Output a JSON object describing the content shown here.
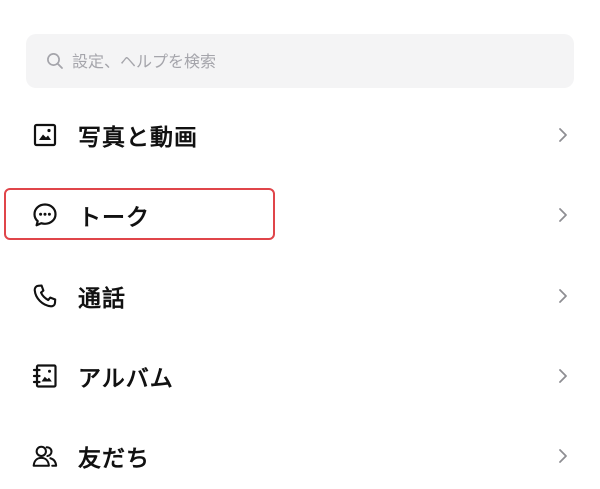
{
  "search": {
    "placeholder": "設定、ヘルプを検索",
    "icon": "search-icon"
  },
  "menu": {
    "items": [
      {
        "label": "写真と動画",
        "icon": "photo-icon"
      },
      {
        "label": "トーク",
        "icon": "chat-bubble-icon"
      },
      {
        "label": "通話",
        "icon": "phone-icon"
      },
      {
        "label": "アルバム",
        "icon": "album-icon"
      },
      {
        "label": "友だち",
        "icon": "friends-icon"
      }
    ],
    "chevron_icon": "chevron-right-icon"
  },
  "colors": {
    "search_bg": "#f4f4f5",
    "placeholder": "#a5a5ab",
    "text": "#111111",
    "chevron": "#8e8e93",
    "highlight": "#e0454a"
  }
}
